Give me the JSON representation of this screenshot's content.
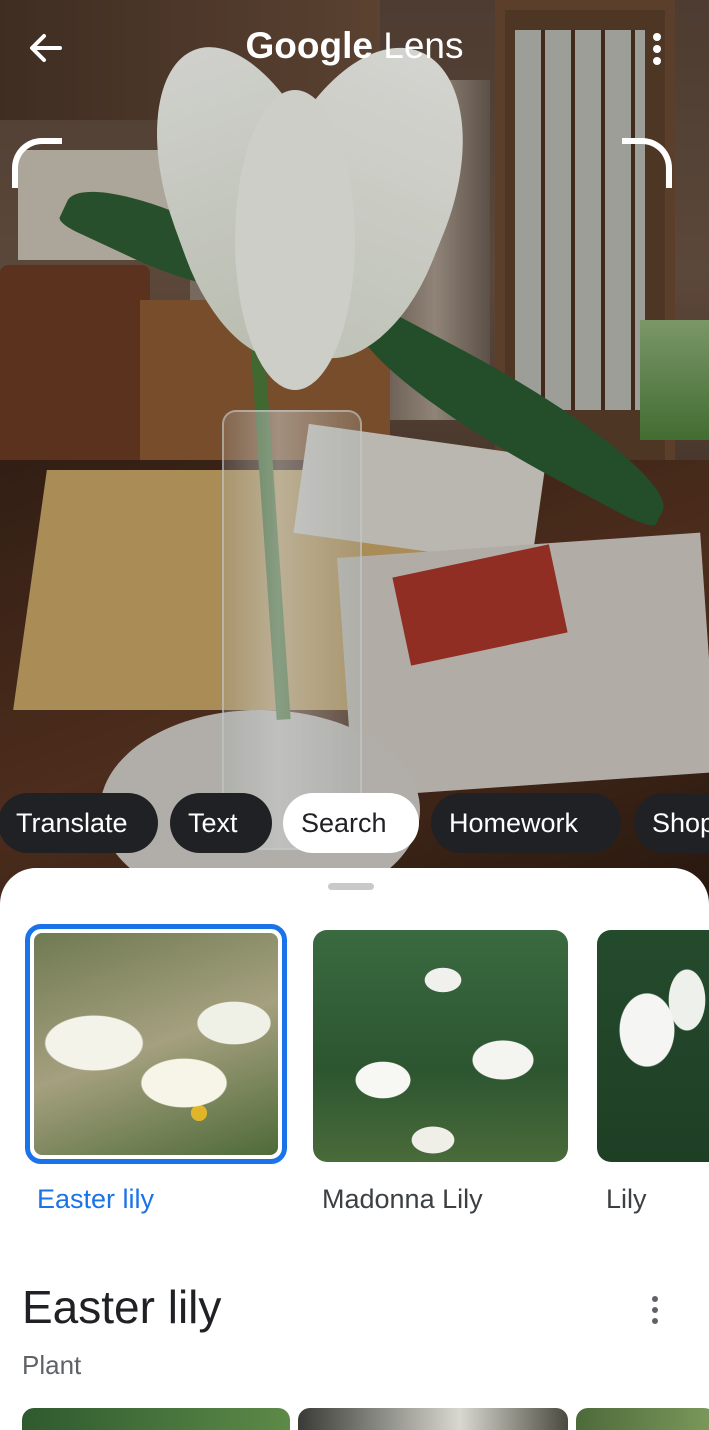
{
  "header": {
    "title_brand": "Google",
    "title_product": " Lens",
    "back_icon": "back-arrow-icon",
    "menu_icon": "more-vert-icon"
  },
  "modes": [
    {
      "label": "Translate",
      "active": false
    },
    {
      "label": "Text",
      "active": false
    },
    {
      "label": "Search",
      "active": true
    },
    {
      "label": "Homework",
      "active": false
    },
    {
      "label": "Shop",
      "active": false
    }
  ],
  "matches": [
    {
      "label": "Easter lily",
      "selected": true
    },
    {
      "label": "Madonna Lily",
      "selected": false
    },
    {
      "label": "Lily",
      "selected": false
    }
  ],
  "result": {
    "title": "Easter lily",
    "subtitle": "Plant",
    "menu_icon": "more-vert-icon"
  },
  "colors": {
    "accent": "#1a73e8",
    "chip_bg": "#202124",
    "chip_active_bg": "#ffffff"
  }
}
